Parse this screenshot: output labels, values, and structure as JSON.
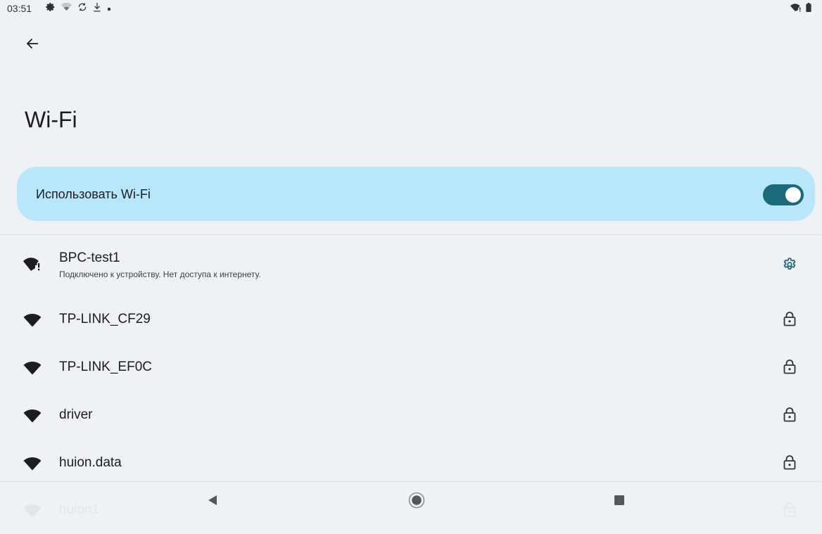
{
  "status_bar": {
    "time": "03:51",
    "left_icons": [
      "settings-icon",
      "wifi-weak-icon",
      "sync-icon",
      "download-icon",
      "dot-icon"
    ],
    "right_icons": [
      "wifi-no-internet-icon",
      "battery-icon"
    ]
  },
  "header": {
    "title": "Wi-Fi"
  },
  "main_toggle": {
    "label": "Использовать Wi-Fi",
    "state": "on",
    "accent_color": "#1a6a7c",
    "card_color": "#b8e6fb"
  },
  "networks": [
    {
      "name": "BPC-test1",
      "status": "Подключено к устройству. Нет доступа к интернету.",
      "connected": true,
      "action_icon": "gear-icon"
    },
    {
      "name": "TP-LINK_CF29",
      "status": "",
      "connected": false,
      "action_icon": "lock-icon"
    },
    {
      "name": "TP-LINK_EF0C",
      "status": "",
      "connected": false,
      "action_icon": "lock-icon"
    },
    {
      "name": "driver",
      "status": "",
      "connected": false,
      "action_icon": "lock-icon"
    },
    {
      "name": "huion.data",
      "status": "",
      "connected": false,
      "action_icon": "lock-icon"
    },
    {
      "name": "huion1",
      "status": "",
      "connected": false,
      "action_icon": "lock-icon"
    }
  ],
  "nav_bar": {
    "buttons": [
      "back-triangle-icon",
      "home-circle-icon",
      "recents-square-icon"
    ]
  }
}
